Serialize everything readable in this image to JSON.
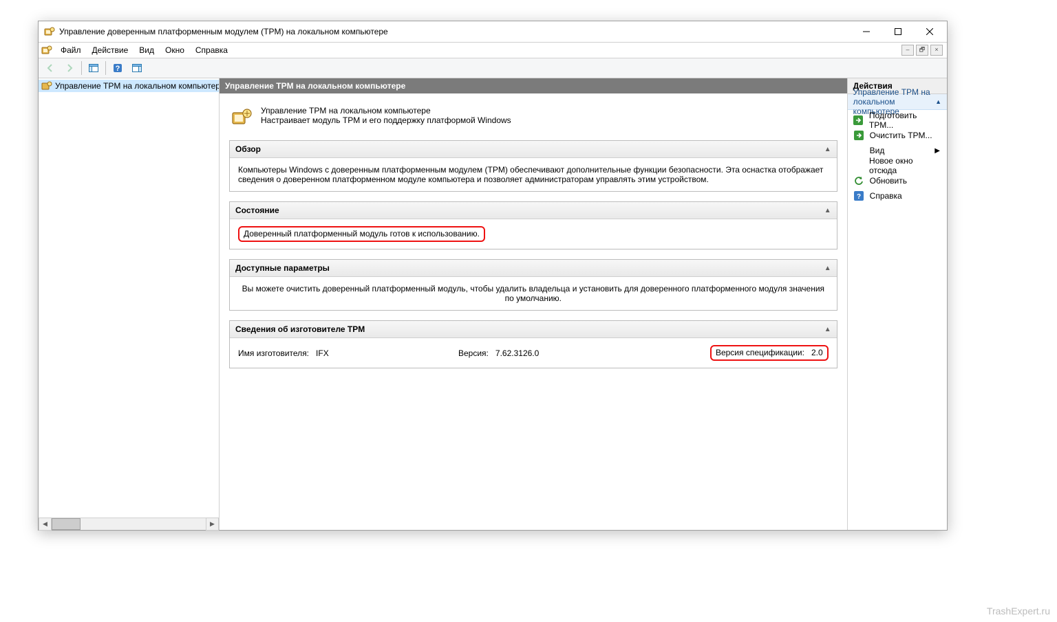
{
  "window": {
    "title": "Управление доверенным платформенным модулем (TPM) на локальном компьютере"
  },
  "menu": {
    "file": "Файл",
    "action": "Действие",
    "view": "Вид",
    "window": "Окно",
    "help": "Справка"
  },
  "tree": {
    "node0": "Управление TPM на локальном компьютере"
  },
  "center": {
    "header": "Управление TPM на локальном компьютере",
    "intro_title": "Управление TPM на локальном компьютере",
    "intro_desc": "Настраивает модуль TPM и его поддержку платформой Windows",
    "overview": {
      "title": "Обзор",
      "text": "Компьютеры Windows с доверенным платформенным модулем (TPM) обеспечивают дополнительные функции безопасности. Эта оснастка отображает сведения о доверенном платформенном модуле компьютера и позволяет администраторам управлять этим устройством."
    },
    "status": {
      "title": "Состояние",
      "text": "Доверенный платформенный модуль готов к использованию."
    },
    "params": {
      "title": "Доступные параметры",
      "text": "Вы можете очистить доверенный платформенный модуль, чтобы удалить владельца и установить для доверенного платформенного модуля значения по умолчанию."
    },
    "mfg": {
      "title": "Сведения об изготовителе TPM",
      "name_label": "Имя изготовителя:",
      "name_value": "IFX",
      "ver_label": "Версия:",
      "ver_value": "7.62.3126.0",
      "spec_label": "Версия спецификации:",
      "spec_value": "2.0"
    }
  },
  "actions": {
    "title": "Действия",
    "context": "Управление TPM на локальном компьютере",
    "prepare": "Подготовить TPM...",
    "clear": "Очистить TPM...",
    "view": "Вид",
    "new_window": "Новое окно отсюда",
    "refresh": "Обновить",
    "help": "Справка"
  },
  "watermark": "TrashExpert.ru"
}
